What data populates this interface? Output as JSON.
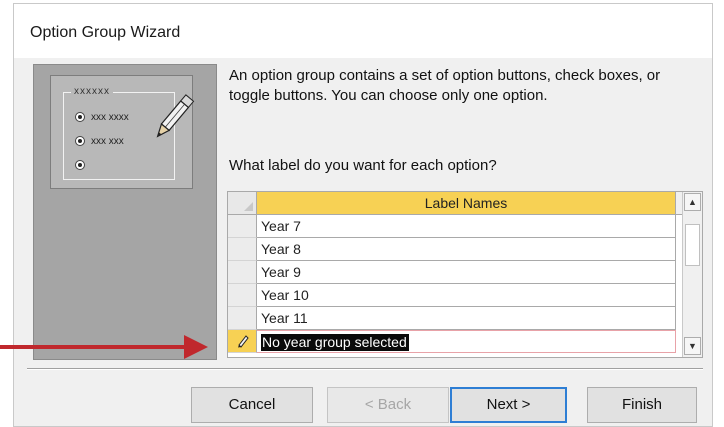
{
  "dialog": {
    "title": "Option Group Wizard"
  },
  "illustration": {
    "legend": "xxxxxx",
    "options": [
      "xxx xxxx",
      "xxx xxx",
      ""
    ]
  },
  "description": "An option group contains a set of option buttons, check boxes, or toggle buttons. You can choose only one option.",
  "question": "What label do you want for each option?",
  "grid": {
    "column_header": "Label Names",
    "rows": [
      "Year 7",
      "Year 8",
      "Year 9",
      "Year 10",
      "Year 11"
    ],
    "editing_value": "No year group selected"
  },
  "buttons": {
    "cancel": "Cancel",
    "back": "< Back",
    "next": "Next >",
    "finish": "Finish"
  },
  "colors": {
    "header_highlight": "#f7d154",
    "annotation_arrow": "#c0282d",
    "default_button_border": "#2e7ed4"
  }
}
